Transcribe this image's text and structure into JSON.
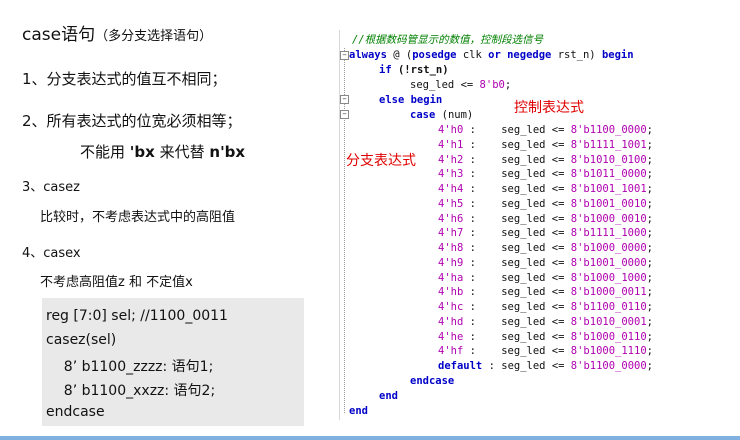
{
  "title": {
    "main": "case语句",
    "note": "（多分支选择语句）"
  },
  "points": {
    "p1": "1、分支表达式的值互不相同；",
    "p2": "2、所有表达式的位宽必须相等；",
    "p2_prefix": "不能用",
    "p2_a": "'bx",
    "p2_mid": "来代替",
    "p2_b": "n'bx",
    "p3": "3、casez",
    "p3_desc": "比较时，不考虑表达式中的高阻值",
    "p4": "4、casex",
    "p4_desc": "不考虑高阻值z 和 不定值x"
  },
  "snippet": {
    "l1": "reg [7:0] sel; //1100_0011",
    "l2": "casez(sel)",
    "l3": "    8’ b1100_zzzz: 语句1;",
    "l4": "    8’ b1100_xxzz: 语句2;",
    "l5": "endcase"
  },
  "code": {
    "comment": "//根据数码管显示的数值，控制段选信号",
    "always": "always",
    "at": "@ (",
    "posedge": "posedge",
    "clk": "clk",
    "or": "or",
    "negedge": "negedge",
    "rst": "rst_n)",
    "begin": "begin",
    "if": "if",
    "if_cond": "(!rst_n)",
    "seg_init": "seg_led <= ",
    "seg_init_val": "8'b0",
    "semi": ";",
    "else_begin": "else begin",
    "case_kw": "case",
    "case_arg": "(num)",
    "seg": "seg_led <= ",
    "cases": [
      {
        "k": "4'h0",
        "v": "8'b1100_0000"
      },
      {
        "k": "4'h1",
        "v": "8'b1111_1001"
      },
      {
        "k": "4'h2",
        "v": "8'b1010_0100"
      },
      {
        "k": "4'h3",
        "v": "8'b1011_0000"
      },
      {
        "k": "4'h4",
        "v": "8'b1001_1001"
      },
      {
        "k": "4'h5",
        "v": "8'b1001_0010"
      },
      {
        "k": "4'h6",
        "v": "8'b1000_0010"
      },
      {
        "k": "4'h7",
        "v": "8'b1111_1000"
      },
      {
        "k": "4'h8",
        "v": "8'b1000_0000"
      },
      {
        "k": "4'h9",
        "v": "8'b1001_0000"
      },
      {
        "k": "4'ha",
        "v": "8'b1000_1000"
      },
      {
        "k": "4'hb",
        "v": "8'b1000_0011"
      },
      {
        "k": "4'hc",
        "v": "8'b1100_0110"
      },
      {
        "k": "4'hd",
        "v": "8'b1010_0001"
      },
      {
        "k": "4'he",
        "v": "8'b1000_0110"
      },
      {
        "k": "4'hf",
        "v": "8'b1000_1110"
      }
    ],
    "default_kw": "default",
    "default_val": "8'b1100_0000",
    "endcase": "endcase",
    "end": "end"
  },
  "annotations": {
    "control": "控制表达式",
    "branch": "分支表达式",
    "color": "#e00000"
  }
}
